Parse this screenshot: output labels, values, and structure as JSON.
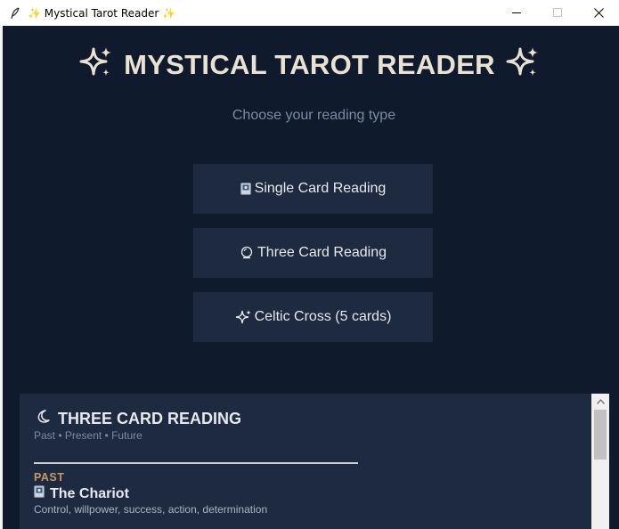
{
  "window": {
    "title": "✨ Mystical Tarot Reader ✨"
  },
  "header": {
    "title": "MYSTICAL TAROT READER",
    "icon": "sparkles-icon"
  },
  "subtitle": "Choose your reading type",
  "reading_buttons": [
    {
      "label": "Single Card Reading",
      "icon": "card-icon"
    },
    {
      "label": "Three Card Reading",
      "icon": "crystal-ball-icon"
    },
    {
      "label": "Celtic Cross (5 cards)",
      "icon": "sparkles-icon"
    }
  ],
  "result": {
    "icon": "crescent-moon-icon",
    "title": "THREE CARD READING",
    "subtitle": "Past • Present • Future",
    "cards": [
      {
        "position": "PAST",
        "icon": "card-icon",
        "name": "The Chariot",
        "keywords": "Control, willpower, success, action, determination"
      }
    ]
  },
  "colors": {
    "background": "#0f1b2d",
    "button_bg": "#1e2a40",
    "title_text": "#e9e2d3",
    "muted_text": "#7b8aa3",
    "position_label": "#c59a67"
  }
}
